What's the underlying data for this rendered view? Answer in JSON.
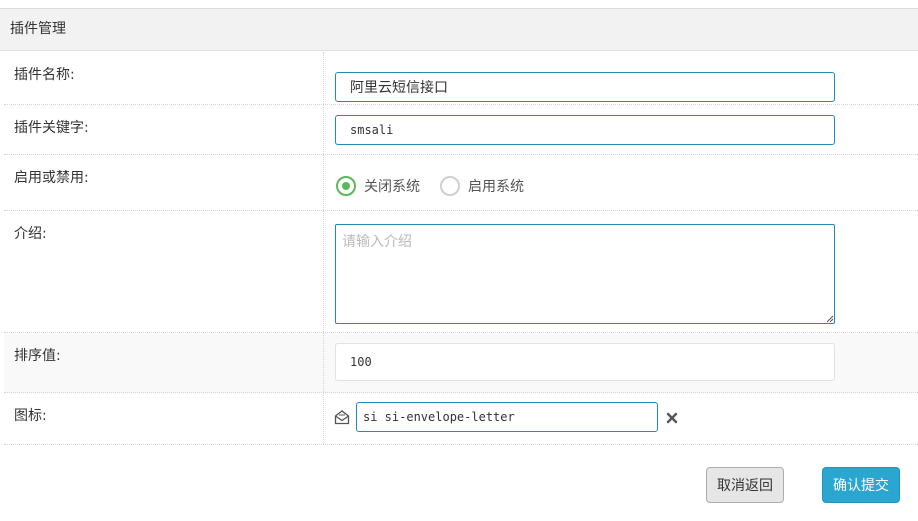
{
  "panel": {
    "title": "插件管理"
  },
  "form": {
    "name": {
      "label": "插件名称:",
      "value": "阿里云短信接口"
    },
    "keyword": {
      "label": "插件关键字:",
      "value": "smsali"
    },
    "status": {
      "label": "启用或禁用:",
      "options": [
        {
          "label": "关闭系统",
          "checked": true
        },
        {
          "label": "启用系统",
          "checked": false
        }
      ]
    },
    "intro": {
      "label": "介绍:",
      "placeholder": "请输入介绍",
      "value": ""
    },
    "sort": {
      "label": "排序值:",
      "value": "100"
    },
    "icon": {
      "label": "图标:",
      "value": "si si-envelope-letter",
      "preview_icon": "envelope-letter-icon",
      "clear_icon": "close-icon"
    }
  },
  "actions": {
    "cancel_label": "取消返回",
    "submit_label": "确认提交"
  },
  "colors": {
    "accent": "#1f8ab7",
    "submit_bg": "#2aa6d1",
    "radio_checked": "#5cb85c",
    "header_bg": "#f2f2f2"
  }
}
